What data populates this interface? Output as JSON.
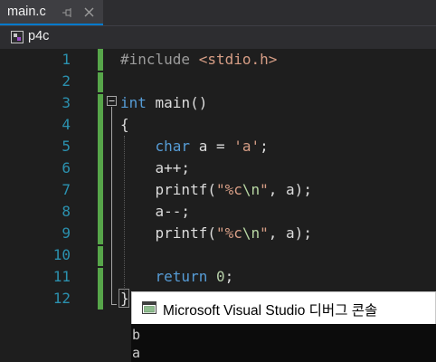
{
  "tab": {
    "title": "main.c"
  },
  "nav": {
    "project": "p4c"
  },
  "editor": {
    "line_numbers": [
      "1",
      "2",
      "3",
      "4",
      "5",
      "6",
      "7",
      "8",
      "9",
      "10",
      "11",
      "12"
    ],
    "lines": [
      [
        {
          "t": "pre",
          "v": "#include "
        },
        {
          "t": "inc",
          "v": "<stdio.h>"
        }
      ],
      [],
      [
        {
          "t": "kw",
          "v": "int"
        },
        {
          "t": "txt",
          "v": " main()"
        }
      ],
      [
        {
          "t": "txt",
          "v": "{"
        }
      ],
      [
        {
          "t": "txt",
          "v": "    "
        },
        {
          "t": "kw",
          "v": "char"
        },
        {
          "t": "txt",
          "v": " a = "
        },
        {
          "t": "str",
          "v": "'a'"
        },
        {
          "t": "txt",
          "v": ";"
        }
      ],
      [
        {
          "t": "txt",
          "v": "    a++;"
        }
      ],
      [
        {
          "t": "txt",
          "v": "    printf("
        },
        {
          "t": "str",
          "v": "\"%c"
        },
        {
          "t": "esc",
          "v": "\\n"
        },
        {
          "t": "str",
          "v": "\""
        },
        {
          "t": "txt",
          "v": ", a);"
        }
      ],
      [
        {
          "t": "txt",
          "v": "    a--;"
        }
      ],
      [
        {
          "t": "txt",
          "v": "    printf("
        },
        {
          "t": "str",
          "v": "\"%c"
        },
        {
          "t": "esc",
          "v": "\\n"
        },
        {
          "t": "str",
          "v": "\""
        },
        {
          "t": "txt",
          "v": ", a);"
        }
      ],
      [],
      [
        {
          "t": "txt",
          "v": "    "
        },
        {
          "t": "kw",
          "v": "return"
        },
        {
          "t": "txt",
          "v": " "
        },
        {
          "t": "num",
          "v": "0"
        },
        {
          "t": "txt",
          "v": ";"
        }
      ],
      [
        {
          "t": "txt",
          "v": "}"
        }
      ]
    ]
  },
  "console": {
    "title": "Microsoft Visual Studio 디버그 콘솔",
    "output": [
      "b",
      "a"
    ]
  },
  "colors": {
    "keyword": "#569cd6",
    "string": "#d69d85",
    "line_number": "#2b91af",
    "change_bar": "#57a64a"
  }
}
